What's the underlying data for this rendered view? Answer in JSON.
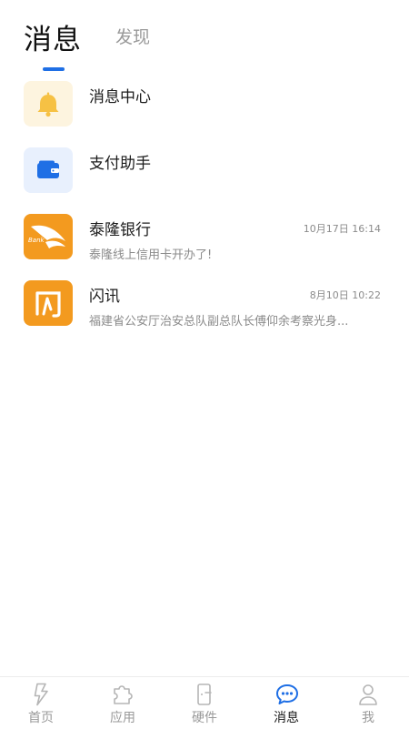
{
  "header": {
    "tabs": [
      {
        "label": "消息",
        "active": true
      },
      {
        "label": "发现",
        "active": false
      }
    ],
    "accent_color": "#1f6fe5"
  },
  "messages": [
    {
      "title": "消息中心",
      "time": "",
      "preview": "",
      "icon": "bell-icon"
    },
    {
      "title": "支付助手",
      "time": "",
      "preview": "",
      "icon": "wallet-icon"
    },
    {
      "title": "泰隆银行",
      "time": "10月17日 16:14",
      "preview": "泰隆线上信用卡开办了!",
      "icon": "bank-logo-icon",
      "logo_text": "Bank"
    },
    {
      "title": "闪讯",
      "time": "8月10日 10:22",
      "preview": "福建省公安厅治安总队副总队长傅仰余考察光身...",
      "icon": "shanxun-logo-icon"
    }
  ],
  "bottom_nav": [
    {
      "label": "首页",
      "icon": "lightning-icon",
      "active": false
    },
    {
      "label": "应用",
      "icon": "puzzle-icon",
      "active": false
    },
    {
      "label": "硬件",
      "icon": "device-icon",
      "active": false
    },
    {
      "label": "消息",
      "icon": "chat-bubble-icon",
      "active": true
    },
    {
      "label": "我",
      "icon": "person-icon",
      "active": false
    }
  ]
}
